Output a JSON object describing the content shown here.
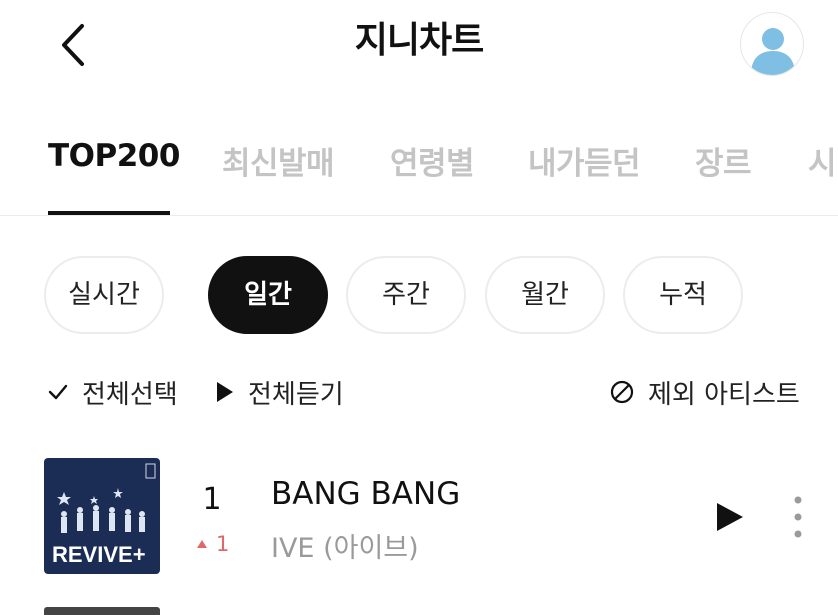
{
  "header": {
    "title": "지니차트"
  },
  "tabs": [
    {
      "label": "TOP200",
      "active": true
    },
    {
      "label": "최신발매",
      "active": false
    },
    {
      "label": "연령별",
      "active": false
    },
    {
      "label": "내가듣던",
      "active": false
    },
    {
      "label": "장르",
      "active": false
    },
    {
      "label": "시",
      "active": false
    }
  ],
  "periods": [
    {
      "label": "실시간",
      "active": false
    },
    {
      "label": "일간",
      "active": true
    },
    {
      "label": "주간",
      "active": false
    },
    {
      "label": "월간",
      "active": false
    },
    {
      "label": "누적",
      "active": false
    }
  ],
  "actions": {
    "select_all": "전체선택",
    "play_all": "전체듣기",
    "exclude_artist": "제외 아티스트"
  },
  "songs": [
    {
      "rank": "1",
      "rank_change": "1",
      "rank_direction": "up",
      "title": "BANG BANG",
      "artist": "IVE (아이브)",
      "album_art_text": "REVIVE+"
    }
  ],
  "colors": {
    "accent": "#111111",
    "inactive_tab": "#c4c4c4",
    "rank_up": "#e0686b",
    "album_bg": "#1c2d55"
  },
  "icons": {
    "back": "chevron-left-icon",
    "avatar": "user-icon",
    "select_all": "check-icon",
    "play_all": "play-icon",
    "exclude_artist": "block-icon",
    "play": "play-icon",
    "more": "more-vertical-icon"
  }
}
